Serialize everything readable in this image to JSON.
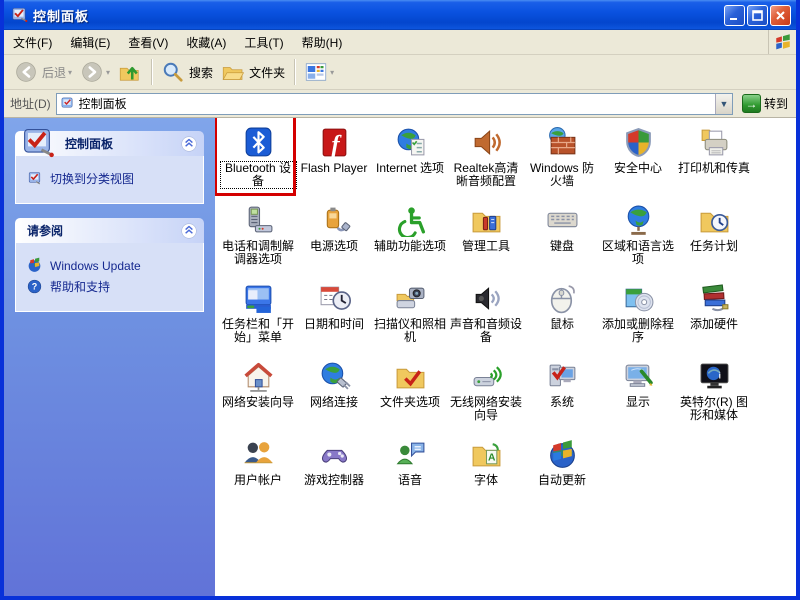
{
  "window": {
    "title": "控制面板"
  },
  "menu": {
    "items": [
      "文件(F)",
      "编辑(E)",
      "查看(V)",
      "收藏(A)",
      "工具(T)",
      "帮助(H)"
    ]
  },
  "toolbar": {
    "back_label": "后退",
    "search_label": "搜索",
    "folders_label": "文件夹"
  },
  "address": {
    "label": "地址(D)",
    "value": "控制面板",
    "go_label": "转到"
  },
  "sidebar": {
    "panels": [
      {
        "title": "控制面板",
        "header_icon": "control-panel-icon",
        "items": [
          {
            "label": "切换到分类视图",
            "icon": "category-view-icon"
          }
        ]
      },
      {
        "title": "请参阅",
        "header_icon": null,
        "items": [
          {
            "label": "Windows Update",
            "icon": "windows-update-icon"
          },
          {
            "label": "帮助和支持",
            "icon": "help-icon"
          }
        ]
      }
    ]
  },
  "main": {
    "highlight_color": "#d40000",
    "items": [
      {
        "label": "Bluetooth 设备",
        "icon": "bluetooth-icon",
        "selected": true,
        "highlighted": true
      },
      {
        "label": "Flash Player",
        "icon": "flash-player-icon"
      },
      {
        "label": "Internet 选项",
        "icon": "internet-options-icon"
      },
      {
        "label": "Realtek高清晰音频配置",
        "icon": "realtek-audio-icon"
      },
      {
        "label": "Windows 防火墙",
        "icon": "windows-firewall-icon"
      },
      {
        "label": "安全中心",
        "icon": "security-center-icon"
      },
      {
        "label": "打印机和传真",
        "icon": "printers-faxes-icon"
      },
      {
        "label": "电话和调制解调器选项",
        "icon": "phone-modem-icon"
      },
      {
        "label": "电源选项",
        "icon": "power-options-icon"
      },
      {
        "label": "辅助功能选项",
        "icon": "accessibility-icon"
      },
      {
        "label": "管理工具",
        "icon": "admin-tools-icon"
      },
      {
        "label": "键盘",
        "icon": "keyboard-icon"
      },
      {
        "label": "区域和语言选项",
        "icon": "regional-language-icon"
      },
      {
        "label": "任务计划",
        "icon": "scheduled-tasks-icon"
      },
      {
        "label": "任务栏和「开始」菜单",
        "icon": "taskbar-startmenu-icon"
      },
      {
        "label": "日期和时间",
        "icon": "date-time-icon"
      },
      {
        "label": "扫描仪和照相机",
        "icon": "scanners-cameras-icon"
      },
      {
        "label": "声音和音频设备",
        "icon": "sounds-audio-icon"
      },
      {
        "label": "鼠标",
        "icon": "mouse-icon"
      },
      {
        "label": "添加或删除程序",
        "icon": "add-remove-programs-icon"
      },
      {
        "label": "添加硬件",
        "icon": "add-hardware-icon"
      },
      {
        "label": "网络安装向导",
        "icon": "network-setup-wizard-icon"
      },
      {
        "label": "网络连接",
        "icon": "network-connections-icon"
      },
      {
        "label": "文件夹选项",
        "icon": "folder-options-icon"
      },
      {
        "label": "无线网络安装向导",
        "icon": "wireless-network-wizard-icon"
      },
      {
        "label": "系统",
        "icon": "system-icon"
      },
      {
        "label": "显示",
        "icon": "display-icon"
      },
      {
        "label": "英特尔(R) 图形和媒体",
        "icon": "intel-graphics-media-icon"
      },
      {
        "label": "用户帐户",
        "icon": "user-accounts-icon"
      },
      {
        "label": "游戏控制器",
        "icon": "game-controllers-icon"
      },
      {
        "label": "语音",
        "icon": "speech-icon"
      },
      {
        "label": "字体",
        "icon": "fonts-icon"
      },
      {
        "label": "自动更新",
        "icon": "automatic-updates-icon"
      }
    ]
  }
}
